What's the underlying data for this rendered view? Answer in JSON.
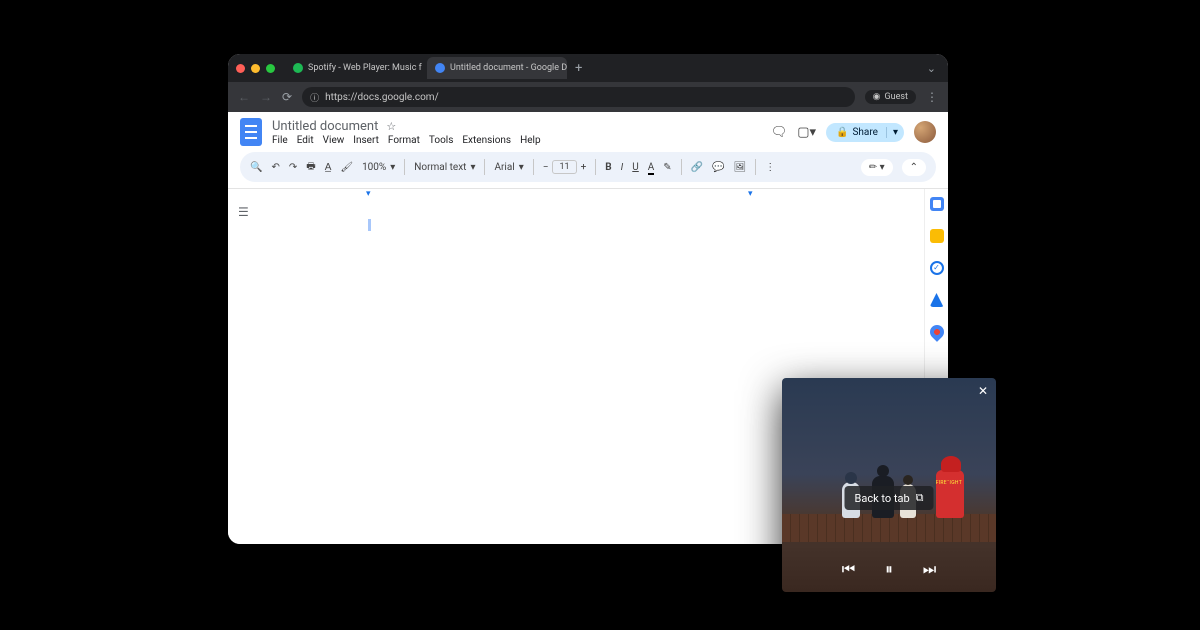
{
  "browser": {
    "tabs": [
      {
        "title": "Spotify - Web Player: Music f",
        "favicon_color": "#1db954",
        "active": false
      },
      {
        "title": "Untitled document - Google D",
        "favicon_color": "#4285f4",
        "active": true
      }
    ],
    "url": "https://docs.google.com/",
    "profile_label": "Guest"
  },
  "docs": {
    "title": "Untitled document",
    "menus": [
      "File",
      "Edit",
      "View",
      "Insert",
      "Format",
      "Tools",
      "Extensions",
      "Help"
    ],
    "share_label": "Share",
    "toolbar": {
      "zoom": "100%",
      "style": "Normal text",
      "font": "Arial",
      "font_size": "11"
    }
  },
  "pip": {
    "back_label": "Back to tab"
  }
}
